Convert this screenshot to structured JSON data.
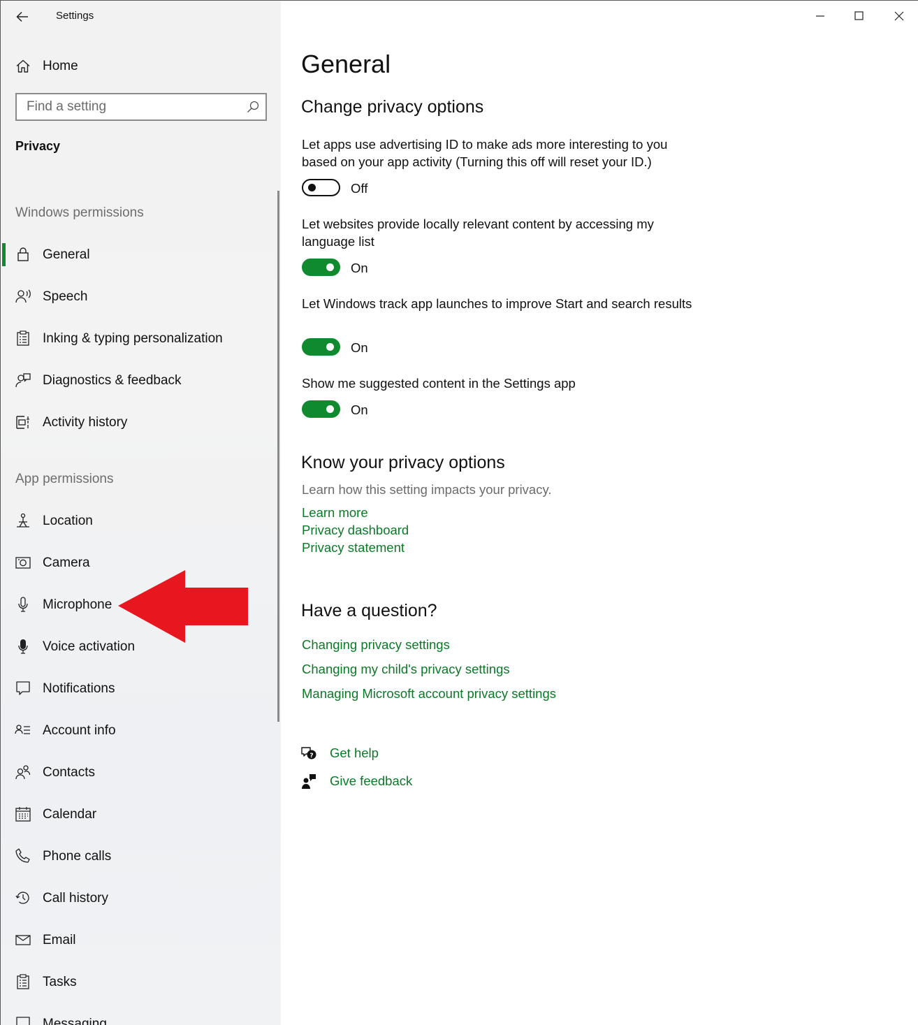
{
  "window": {
    "title": "Settings"
  },
  "sidebar": {
    "home_label": "Home",
    "search_placeholder": "Find a setting",
    "section_title": "Privacy",
    "windows_permissions_header": "Windows permissions",
    "windows_permissions": [
      {
        "label": "General",
        "icon": "lock-icon",
        "active": true
      },
      {
        "label": "Speech",
        "icon": "speech-icon"
      },
      {
        "label": "Inking & typing personalization",
        "icon": "clipboard-icon"
      },
      {
        "label": "Diagnostics & feedback",
        "icon": "diagnostics-icon"
      },
      {
        "label": "Activity history",
        "icon": "activity-history-icon"
      }
    ],
    "app_permissions_header": "App permissions",
    "app_permissions": [
      {
        "label": "Location",
        "icon": "location-icon"
      },
      {
        "label": "Camera",
        "icon": "camera-icon"
      },
      {
        "label": "Microphone",
        "icon": "microphone-icon"
      },
      {
        "label": "Voice activation",
        "icon": "voice-activation-icon"
      },
      {
        "label": "Notifications",
        "icon": "notifications-icon"
      },
      {
        "label": "Account info",
        "icon": "account-info-icon"
      },
      {
        "label": "Contacts",
        "icon": "contacts-icon"
      },
      {
        "label": "Calendar",
        "icon": "calendar-icon"
      },
      {
        "label": "Phone calls",
        "icon": "phone-icon"
      },
      {
        "label": "Call history",
        "icon": "call-history-icon"
      },
      {
        "label": "Email",
        "icon": "email-icon"
      },
      {
        "label": "Tasks",
        "icon": "tasks-icon"
      },
      {
        "label": "Messaging",
        "icon": "messaging-icon"
      }
    ]
  },
  "main": {
    "title": "General",
    "change_header": "Change privacy options",
    "settings": [
      {
        "desc": "Let apps use advertising ID to make ads more interesting to you based on your app activity (Turning this off will reset your ID.)",
        "state": "Off",
        "on": false
      },
      {
        "desc": "Let websites provide locally relevant content by accessing my language list",
        "state": "On",
        "on": true
      },
      {
        "desc": "Let Windows track app launches to improve Start and search results",
        "state": "On",
        "on": true
      },
      {
        "desc": "Show me suggested content in the Settings app",
        "state": "On",
        "on": true
      }
    ],
    "know_header": "Know your privacy options",
    "know_desc": "Learn how this setting impacts your privacy.",
    "know_links": [
      "Learn more",
      "Privacy dashboard",
      "Privacy statement"
    ],
    "question_header": "Have a question?",
    "question_links": [
      "Changing privacy settings",
      "Changing my child's privacy settings",
      "Managing Microsoft account privacy settings"
    ],
    "get_help": "Get help",
    "give_feedback": "Give feedback"
  },
  "colors": {
    "accent": "#108a2e",
    "link": "#0b7a26",
    "annotation_arrow": "#e8161f"
  }
}
